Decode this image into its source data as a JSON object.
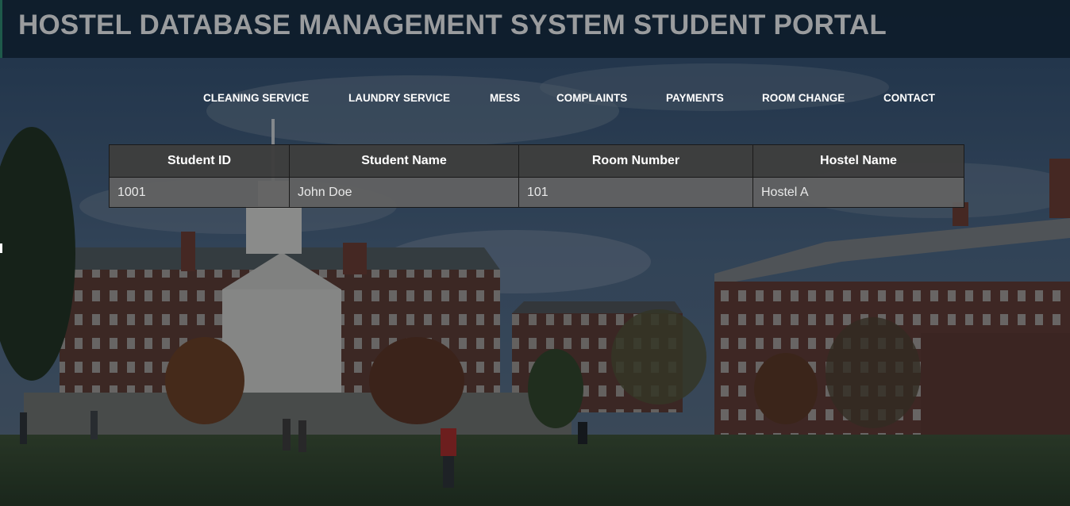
{
  "header": {
    "title": "HOSTEL DATABASE MANAGEMENT SYSTEM STUDENT PORTAL"
  },
  "nav": {
    "items": [
      {
        "label": "CLEANING SERVICE"
      },
      {
        "label": "LAUNDRY SERVICE"
      },
      {
        "label": "MESS"
      },
      {
        "label": "COMPLAINTS"
      },
      {
        "label": "PAYMENTS"
      },
      {
        "label": "ROOM CHANGE"
      },
      {
        "label": "CONTACT"
      }
    ]
  },
  "table": {
    "headers": [
      "Student ID",
      "Student Name",
      "Room Number",
      "Hostel Name"
    ],
    "rows": [
      [
        "1001",
        "John Doe",
        "101",
        "Hostel A"
      ]
    ]
  },
  "colors": {
    "header_bg": "#0e1c2a",
    "title_text": "#9a9c9e",
    "nav_text": "#ffffff",
    "table_header_bg": "#3e3e3e",
    "table_cell_bg": "#626262"
  }
}
